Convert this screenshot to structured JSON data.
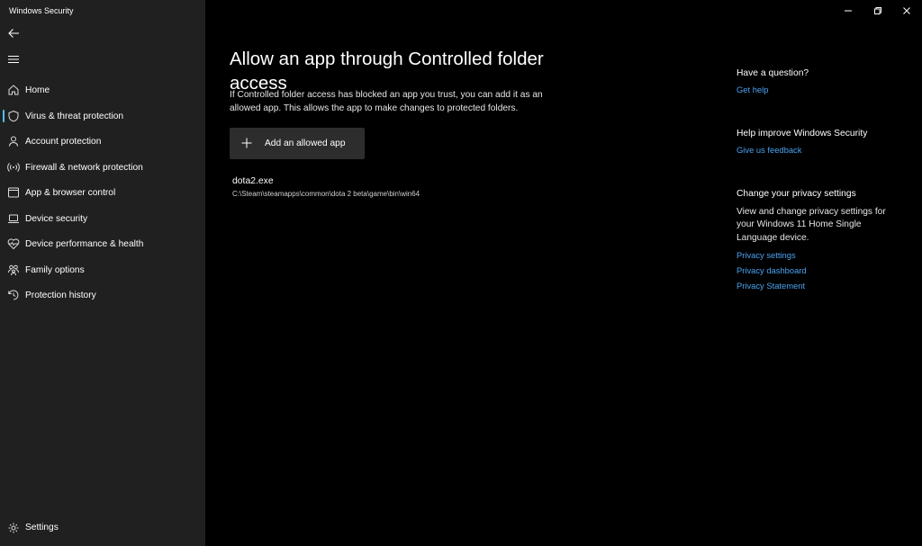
{
  "window": {
    "title": "Windows Security",
    "controls": [
      "minimize-icon",
      "restore-icon",
      "close-icon"
    ]
  },
  "sidebar": {
    "back_icon": "back-arrow-icon",
    "menu_icon": "hamburger-menu-icon",
    "selected": "Virus & threat protection",
    "items": [
      {
        "label": "Home",
        "icon": "home-icon"
      },
      {
        "label": "Virus & threat protection",
        "icon": "shield-icon"
      },
      {
        "label": "Account protection",
        "icon": "person-icon"
      },
      {
        "label": "Firewall & network protection",
        "icon": "wireless-icon"
      },
      {
        "label": "App & browser control",
        "icon": "browser-window-icon"
      },
      {
        "label": "Device security",
        "icon": "laptop-icon"
      },
      {
        "label": "Device performance & health",
        "icon": "heart-pulse-icon"
      },
      {
        "label": "Family options",
        "icon": "family-icon"
      },
      {
        "label": "Protection history",
        "icon": "history-icon"
      }
    ],
    "settings": {
      "label": "Settings",
      "icon": "gear-icon"
    }
  },
  "main": {
    "title": "Allow an app through Controlled folder access",
    "description": "If Controlled folder access has blocked an app you trust, you can add it as an allowed app. This allows the app to make changes to protected folders.",
    "add_button": "Add an allowed app",
    "allowed_apps": [
      {
        "name": "dota2.exe",
        "path": "C:\\Steam\\steamapps\\common\\dota 2 beta\\game\\bin\\win64"
      }
    ]
  },
  "right_panel": {
    "question": {
      "heading": "Have a question?",
      "link": "Get help"
    },
    "improve": {
      "heading": "Help improve Windows Security",
      "link": "Give us feedback"
    },
    "privacy": {
      "heading": "Change your privacy settings",
      "text": "View and change privacy settings for your Windows 11 Home Single Language device.",
      "links": [
        "Privacy settings",
        "Privacy dashboard",
        "Privacy Statement"
      ]
    }
  },
  "colors": {
    "accent": "#4cc2ff",
    "link": "#4aa3f0",
    "sidebar_bg": "#202020",
    "main_bg": "#000000",
    "button_bg": "#2d2d2d"
  }
}
